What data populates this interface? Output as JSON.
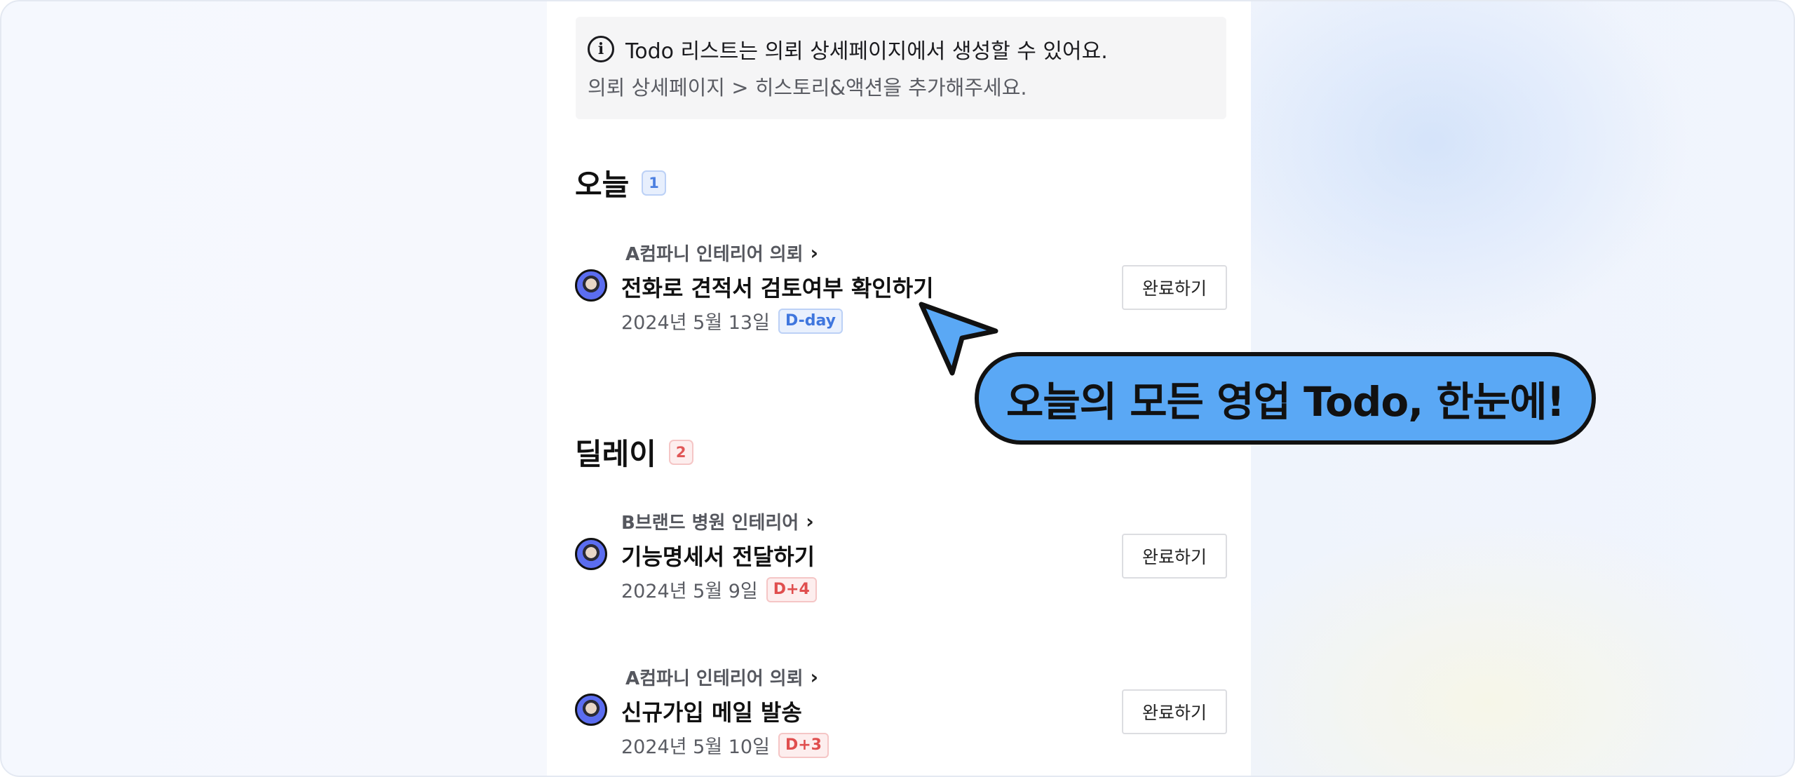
{
  "info": {
    "line1": "Todo 리스트는 의뢰 상세페이지에서 생성할 수 있어요.",
    "line2": "의뢰 상세페이지 > 히스토리&액션을 추가해주세요.",
    "icon": "info-circle-icon"
  },
  "sections": {
    "today": {
      "title": "오늘",
      "count": "1"
    },
    "delay": {
      "title": "딜레이",
      "count": "2"
    }
  },
  "todos": [
    {
      "project": "A컴파니 인테리어 의뢰",
      "title": "전화로 견적서 검토여부 확인하기",
      "date": "2024년 5월 13일",
      "dday": "D-day",
      "button": "완료하기"
    },
    {
      "project": "B브랜드 병원 인테리어",
      "title": "기능명세서 전달하기",
      "date": "2024년 5월 9일",
      "dday": "D+4",
      "button": "완료하기"
    },
    {
      "project": "A컴파니 인테리어 의뢰",
      "title": "신규가입 메일 발송",
      "date": "2024년 5월 10일",
      "dday": "D+3",
      "button": "완료하기"
    }
  ],
  "callout": {
    "text": "오늘의 모든 영업 Todo, 한눈에!"
  },
  "colors": {
    "accent_blue": "#5aa8f5",
    "badge_blue": "#3f76de",
    "badge_red": "#e04e4e"
  }
}
